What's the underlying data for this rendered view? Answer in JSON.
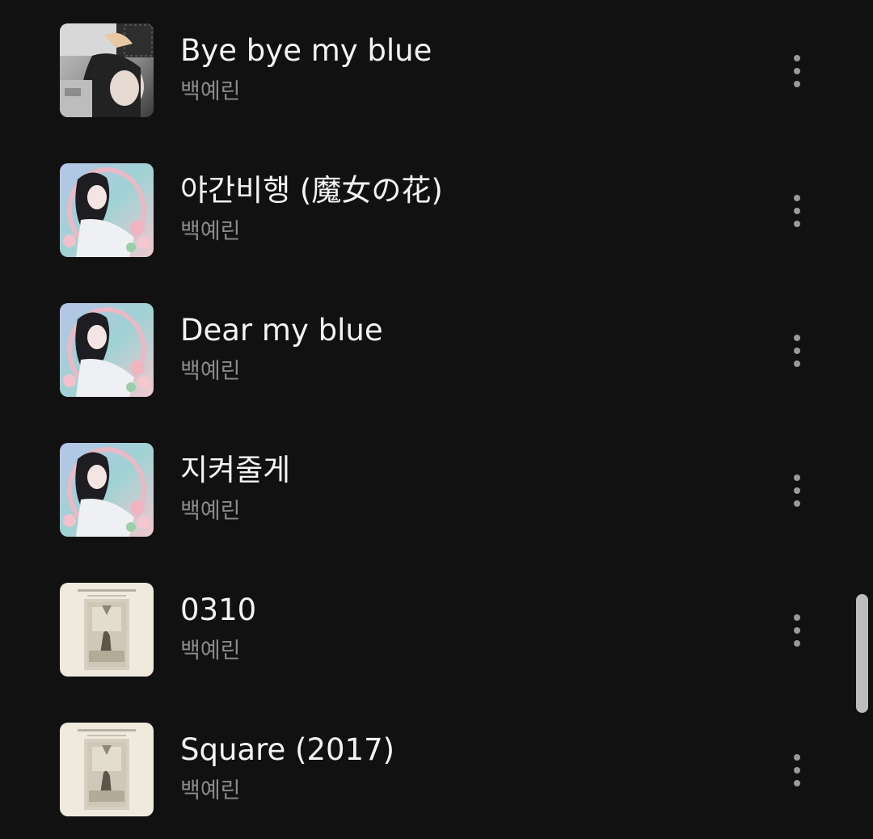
{
  "songs": [
    {
      "title": "Bye bye my blue",
      "artist": "백예린",
      "art": "album-art-bye-bye-my-blue",
      "more_icon": "more-vert-icon"
    },
    {
      "title": "야간비행 (魔女の花)",
      "artist": "백예린",
      "art": "album-art-our-love-is-great",
      "more_icon": "more-vert-icon"
    },
    {
      "title": "Dear my blue",
      "artist": "백예린",
      "art": "album-art-our-love-is-great",
      "more_icon": "more-vert-icon"
    },
    {
      "title": "지켜줄게",
      "artist": "백예린",
      "art": "album-art-our-love-is-great",
      "more_icon": "more-vert-icon"
    },
    {
      "title": "0310",
      "artist": "백예린",
      "art": "album-art-every-letter",
      "more_icon": "more-vert-icon"
    },
    {
      "title": "Square (2017)",
      "artist": "백예린",
      "art": "album-art-every-letter",
      "more_icon": "more-vert-icon"
    }
  ],
  "colors": {
    "background": "#111111",
    "title": "#f4f4f4",
    "artist": "#8a8a8a",
    "more_dots": "#9a9a9a",
    "scrollbar": "#bdbdbd"
  }
}
